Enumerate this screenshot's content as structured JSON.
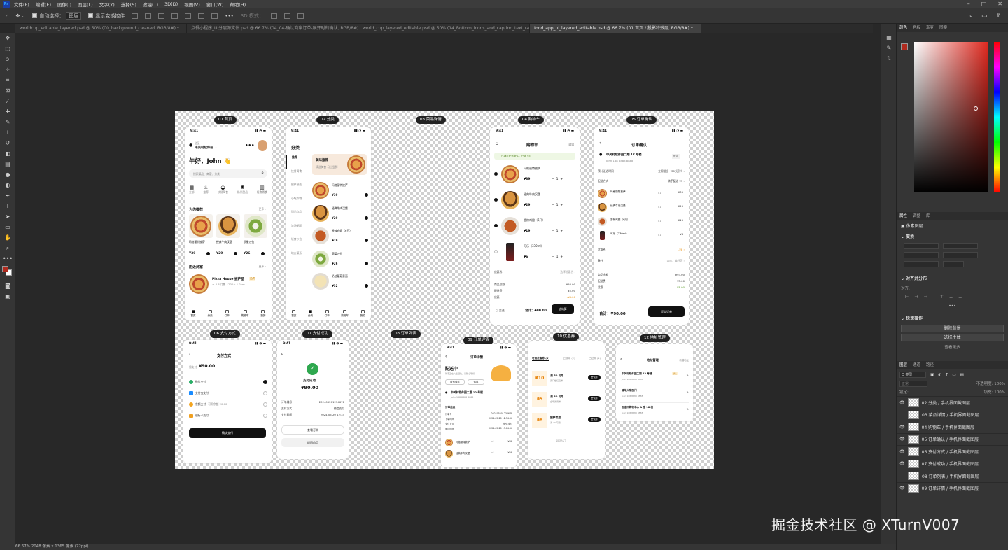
{
  "menu": [
    "文件(F)",
    "编辑(E)",
    "图像(I)",
    "图层(L)",
    "文字(Y)",
    "选择(S)",
    "滤镜(T)",
    "3D(D)",
    "视图(V)",
    "窗口(W)",
    "帮助(H)"
  ],
  "options": {
    "auto_select": "自动选择：",
    "auto_select_val": "图层",
    "show_transform": "显示变换控件",
    "mode3d": "3D 模式："
  },
  "tabs": [
    "worldcup_editable_layered.psd @ 50% (00_background_cleaned, RGB/8#) *",
    "点餐小程序_UI分层源文件.psd @ 66.7% (04_04-确认商家订单-展开时的确认, RGB/8#) *",
    "world_cup_layered_editable.psd @ 50% (14_Bottom_icons_and_caption_text_raster_layer, RGB/8#) *",
    "food_app_ui_layered_editable.psd @ 66.7% (01 首页 / 投影特效层, RGB/8#) *"
  ],
  "status": "66.67%    2048 像素 x 1365 像素 (72ppi)",
  "watermark": "掘金技术社区 @ XTurnV007",
  "panels": {
    "color_tabs": [
      "颜色",
      "色板",
      "渐变",
      "图案"
    ],
    "prop_tabs": [
      "属性",
      "调整",
      "库"
    ],
    "pixel_layer": "像素图层",
    "transform": "变换",
    "align": "对齐并分布",
    "align_label": "对齐:",
    "quick": "快速操作",
    "quick_btns": [
      "删除背景",
      "选择主体",
      "查看更多"
    ],
    "layer_tabs": [
      "图层",
      "通道",
      "路径"
    ],
    "kind": "Q 类型",
    "blend": "正常",
    "opacity": "不透明度: 100%",
    "lock": "锁定:",
    "fill": "填充: 100%",
    "layers": [
      "02 分类 / 手机界面截图层",
      "03 菜品详情 / 手机界面截图层",
      "04 购物车 / 手机界面截图层",
      "05 订单确认 / 手机界面截图层",
      "06 支付方式 / 手机界面截图层",
      "07 支付成功 / 手机界面截图层",
      "08 订单列表 / 手机界面截图层",
      "09 订单详情 / 手机界面截图层"
    ]
  },
  "artboards": {
    "labels": [
      "01 首页",
      "02 分类",
      "03 菜品详情",
      "04 购物车",
      "05 订单确认",
      "06 支付方式",
      "07 支付成功",
      "08 订单列表",
      "09 订单详情",
      "10 优惠券",
      "12 地址管理"
    ],
    "time": "9:41",
    "home": {
      "loc_small": "送至",
      "loc": "中关村软件园 ⌄",
      "greet": "午好，John 👋",
      "search": "搜索菜品、商家、分类",
      "cats": [
        "全部",
        "推荐",
        "快餐简食",
        "奶茶甜品",
        "轻食素食"
      ],
      "sec1": "为你推荐",
      "more": "更多 ›",
      "items": [
        {
          "n": "玛格丽特披萨",
          "p": "¥39"
        },
        {
          "n": "经典牛肉汉堡",
          "p": "¥29"
        },
        {
          "n": "凯撒沙拉",
          "p": "¥26"
        }
      ],
      "sec2": "附近商家",
      "shop": "Pizza House 披萨屋",
      "shop_tag": "品质",
      "shop_meta": "★ 4.8  月售 1200+  1.2km",
      "nav": [
        "首页",
        "分类",
        "订单",
        "购物车",
        "我的"
      ]
    },
    "category": {
      "title": "分类",
      "side": [
        "推荐",
        "快餐简食",
        "披萨意面",
        "小吃炸物",
        "甜品饮品",
        "浓汤粥面",
        "轻食沙拉",
        "地方菜系"
      ],
      "banner": "美味推荐",
      "banner_sub": "精选美食 马上尝鲜",
      "items": [
        {
          "n": "玛格丽特披萨",
          "p": "¥39"
        },
        {
          "n": "经典牛肉汉堡",
          "p": "¥29"
        },
        {
          "n": "香辣鸡翅（6只）",
          "p": "¥19"
        },
        {
          "n": "蔬菜沙拉",
          "p": "¥26"
        },
        {
          "n": "奶油蘑菇意面",
          "p": "¥32"
        }
      ]
    },
    "cart": {
      "title": "购物车",
      "edit": "编辑",
      "notice": "已满足配送条件，已减 ¥5",
      "items": [
        {
          "n": "玛格丽特披萨",
          "p": "¥39",
          "q": "1"
        },
        {
          "n": "经典牛肉汉堡",
          "p": "¥29",
          "q": "1"
        },
        {
          "n": "香辣鸡翅（6只）",
          "p": "¥19",
          "q": "1"
        },
        {
          "n": "可乐（330ml）",
          "p": "¥6",
          "q": "1"
        }
      ],
      "coupon": "优惠券",
      "coupon_v": "选择优惠券 ›",
      "sum": [
        [
          "商品总额",
          "¥93.00"
        ],
        [
          "配送费",
          "¥5.00"
        ],
        [
          "优惠",
          "-¥8.00"
        ]
      ],
      "all": "全选",
      "total": "合计：¥90.00",
      "btn": "去结算"
    },
    "confirm": {
      "title": "订单确认",
      "addr": "中关村软件园二期 12 号楼",
      "name": "John  188 8888 8888",
      "tag": "默认",
      "time_l": "预计送达时间",
      "time_v": "立即送出（30 分钟）›",
      "method_l": "配送方式",
      "method_v": "骑手配送  ¥3 ›",
      "items": [
        {
          "n": "玛格丽特披萨",
          "q": "x1",
          "p": "¥39"
        },
        {
          "n": "经典牛肉汉堡",
          "q": "x1",
          "p": "¥29"
        },
        {
          "n": "香辣鸡翅（6只）",
          "q": "x1",
          "p": "¥19"
        },
        {
          "n": "可乐（330ml）",
          "q": "x1",
          "p": "¥6"
        }
      ],
      "coupon": "优惠券",
      "coupon_v": "-¥8 ›",
      "note": "备注",
      "note_v": "口味、偏好等 ›",
      "sum": [
        [
          "商品金额",
          "¥93.00"
        ],
        [
          "配送费",
          "¥5.00"
        ],
        [
          "优惠",
          "-¥8.00"
        ]
      ],
      "total": "合计：¥90.00",
      "btn": "提交订单"
    },
    "pay": {
      "title": "支付方式",
      "amount_l": "需支付",
      "amount": "¥90.00",
      "methods": [
        "微信支付",
        "支付宝支付",
        "余额支付",
        "银行卡支付"
      ],
      "balance": "可用余额 ¥0.00",
      "btn": "确认支付"
    },
    "success": {
      "title": "支付成功",
      "amount": "¥90.00",
      "rows": [
        [
          "订单编号",
          "202405201234678"
        ],
        [
          "支付方式",
          "微信支付"
        ],
        [
          "支付时间",
          "2024-05-20 12:34"
        ]
      ],
      "btn1": "查看订单",
      "btn2": "返回首页"
    },
    "detail": {
      "title": "订单详情",
      "status": "配送中",
      "status_sub": "骑手正在火速赶往，请耐心等候",
      "btn1": "联系骑手",
      "btn2": "催单",
      "addr": "中关村软件园二期 12 号楼",
      "name": "John  188 8888 8888",
      "info": "订单信息",
      "rows": [
        [
          "订单号",
          "202405201234678"
        ],
        [
          "下单时间",
          "2024-05-20 12:34:56"
        ],
        [
          "支付方式",
          "微信支付"
        ],
        [
          "配送时间",
          "2024-05-20 13:04:56"
        ]
      ],
      "items": [
        {
          "n": "玛格丽特披萨",
          "q": "x1",
          "p": "¥39"
        },
        {
          "n": "经典牛肉汉堡",
          "q": "x1",
          "p": "¥29"
        }
      ]
    },
    "coupon": {
      "tabs": [
        "可用优惠券 (3)",
        "已使用 (2)",
        "已过期 (1)"
      ],
      "items": [
        {
          "v": "¥10",
          "c": "满 50 可用",
          "sub": "无门槛红包券"
        },
        {
          "v": "¥5",
          "c": "满 30 可用",
          "sub": "全场通用券"
        },
        {
          "v": "¥8",
          "c": "披萨专用",
          "sub": "满 40 可用"
        }
      ],
      "btn": "去使用",
      "foot": "没有更多了"
    },
    "address": {
      "title": "地址管理",
      "add": "新增地址",
      "items": [
        {
          "a": "中关村软件园二期 12 号楼",
          "n": "John  188 8888 8888",
          "tag": "默认"
        },
        {
          "a": "清华大学西门",
          "n": "John  188 8888 8888"
        },
        {
          "a": "五道口购物中心 A 座 18 楼",
          "n": "John  188 8888 8888"
        }
      ]
    }
  }
}
